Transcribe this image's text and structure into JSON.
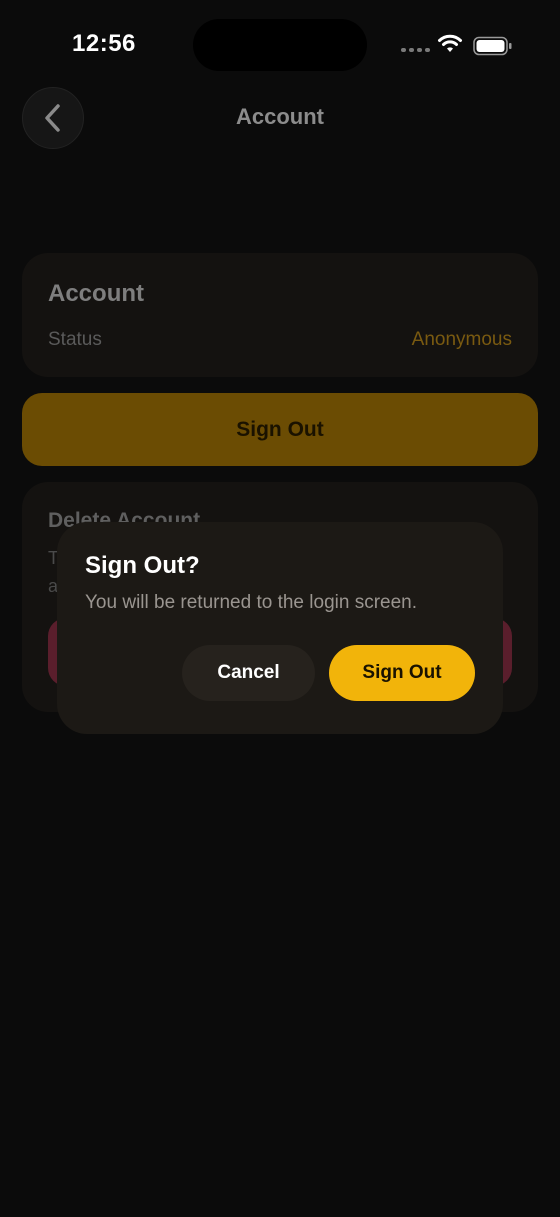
{
  "status_bar": {
    "time": "12:56"
  },
  "header": {
    "title": "Account"
  },
  "account_card": {
    "title": "Account",
    "status_label": "Status",
    "status_value": "Anonymous"
  },
  "sign_out_button": {
    "label": "Sign Out"
  },
  "delete_card": {
    "title": "Delete Account",
    "description": "T\na"
  },
  "dialog": {
    "title": "Sign Out?",
    "message": "You will be returned to the login screen.",
    "cancel_label": "Cancel",
    "confirm_label": "Sign Out"
  },
  "colors": {
    "accent": "#f2b40a",
    "background": "#0b0b0b",
    "dialog": "#1c1915",
    "destructive_dimmed": "#5a1e2c"
  },
  "icons": {
    "back": "chevron-left-icon",
    "wifi": "wifi-icon",
    "battery": "battery-icon",
    "signal": "cellular-signal-icon"
  }
}
